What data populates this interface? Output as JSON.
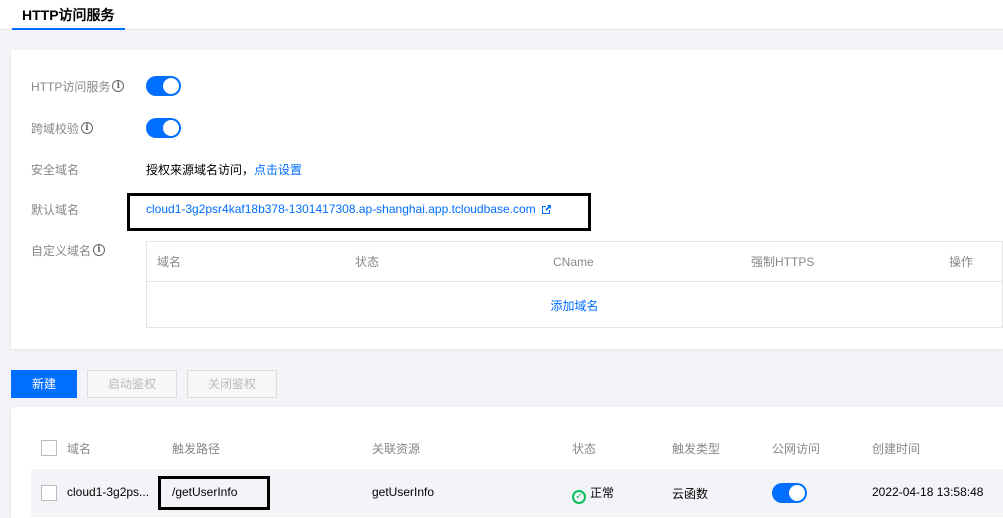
{
  "tab": {
    "label": "HTTP访问服务"
  },
  "settings": {
    "http_service": {
      "label": "HTTP访问服务",
      "enabled": true
    },
    "cors": {
      "label": "跨域校验",
      "enabled": true
    },
    "safe_domain": {
      "label": "安全域名",
      "text": "授权来源域名访问，",
      "link": "点击设置"
    },
    "default_domain": {
      "label": "默认域名",
      "value": "cloud1-3g2psr4kaf18b378-1301417308.ap-shanghai.app.tcloudbase.com"
    },
    "custom_domain": {
      "label": "自定义域名",
      "columns": [
        "域名",
        "状态",
        "CName",
        "强制HTTPS",
        "操作"
      ],
      "add_link": "添加域名"
    }
  },
  "toolbar": {
    "new_label": "新建",
    "enable_auth_label": "启动鉴权",
    "disable_auth_label": "关闭鉴权"
  },
  "routes": {
    "columns": [
      "域名",
      "触发路径",
      "关联资源",
      "状态",
      "触发类型",
      "公网访问",
      "创建时间"
    ],
    "rows": [
      {
        "domain": "cloud1-3g2ps...",
        "path": "/getUserInfo",
        "resource": "getUserInfo",
        "status": "正常",
        "trigger_type": "云函数",
        "public_access": true,
        "created": "2022-04-18 13:58:48"
      }
    ]
  },
  "colors": {
    "accent": "#006eff",
    "success": "#0abf5b"
  },
  "icons": {
    "info": "info-circle-icon",
    "external": "external-link-icon",
    "status_ok": "check-circle-icon"
  }
}
